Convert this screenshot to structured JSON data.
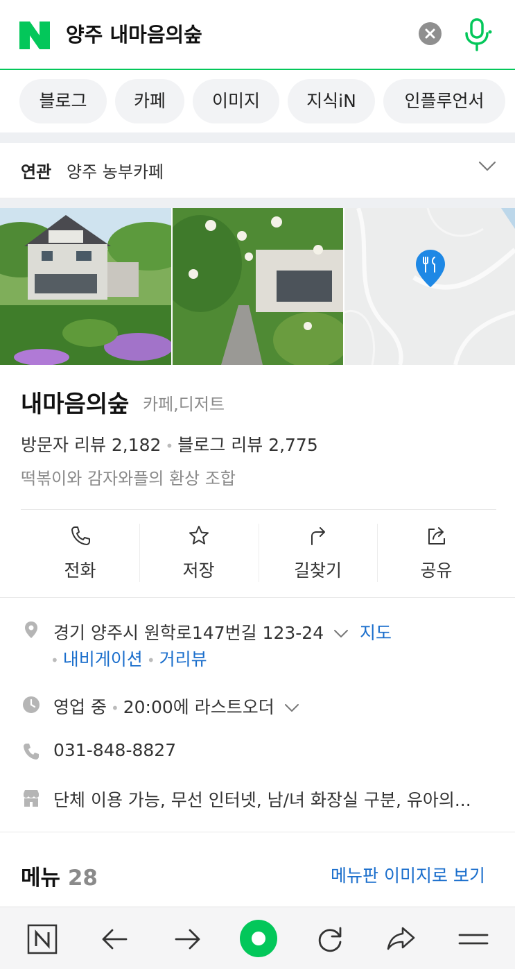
{
  "search": {
    "query": "양주 내마음의숲"
  },
  "chips": [
    "블로그",
    "카페",
    "이미지",
    "지식iN",
    "인플루언서"
  ],
  "related": {
    "label": "연관",
    "value": "양주 농부카페"
  },
  "place": {
    "name": "내마음의숲",
    "category": "카페,디저트",
    "visitor_reviews_label": "방문자 리뷰 2,182",
    "blog_reviews_label": "블로그 리뷰 2,775",
    "dot": "•",
    "tagline": "떡볶이와 감자와플의 환상 조합"
  },
  "actions": [
    {
      "label": "전화",
      "icon": "phone-icon"
    },
    {
      "label": "저장",
      "icon": "star-icon"
    },
    {
      "label": "길찾기",
      "icon": "directions-icon"
    },
    {
      "label": "공유",
      "icon": "share-icon"
    }
  ],
  "info": {
    "address": "경기 양주시 원학로147번길 123-24",
    "map_link": "지도",
    "nav_link": "내비게이션",
    "street_link": "거리뷰",
    "hours_status": "영업 중",
    "hours_detail": "20:00에 라스트오더",
    "phone": "031-848-8827",
    "amenities": "단체 이용 가능, 무선 인터넷, 남/녀 화장실 구분, 유아의..."
  },
  "menu": {
    "title": "메뉴",
    "count": "28",
    "view_link": "메뉴판 이미지로 보기"
  },
  "colors": {
    "brand": "#03c75a",
    "link": "#1a6ecc",
    "map_pin": "#1e88e5"
  }
}
